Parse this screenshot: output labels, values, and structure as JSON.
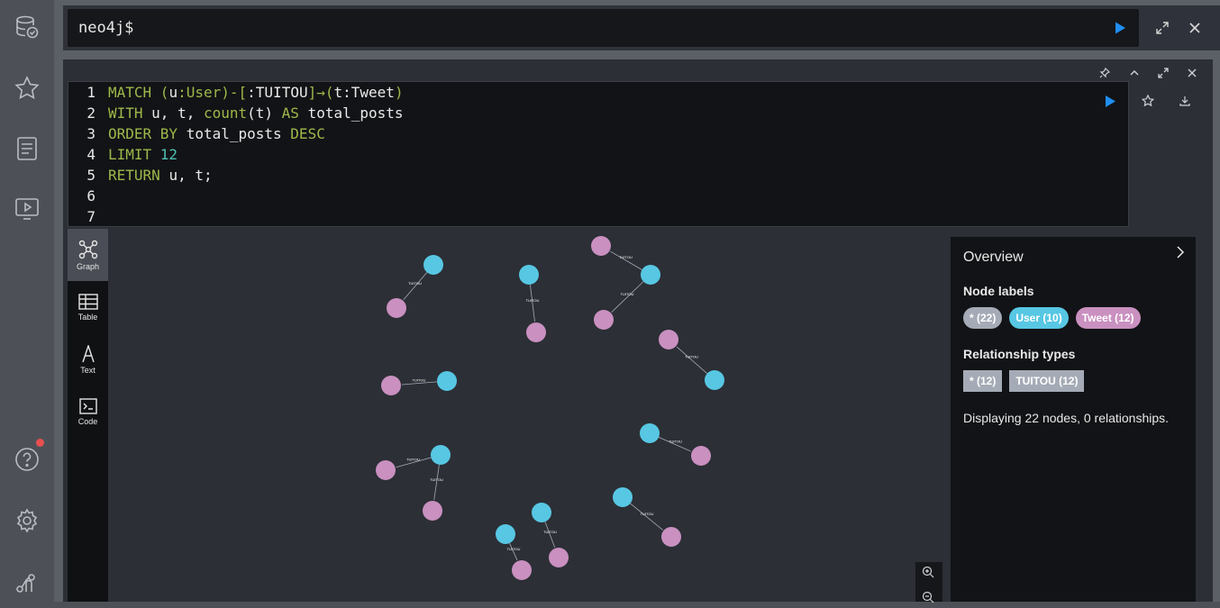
{
  "sidebar": {
    "items": [
      "database-icon",
      "star-icon",
      "document-icon",
      "play-guide-icon",
      "help-icon",
      "settings-icon",
      "neo4j-icon"
    ],
    "help_notification_color": "#e94f4f"
  },
  "editor": {
    "prompt": "neo4j$",
    "run_color": "#1f8ef1"
  },
  "query": {
    "lines": [
      {
        "num": "1",
        "tokens": [
          {
            "t": "MATCH",
            "c": "kw"
          },
          {
            "t": " (",
            "c": "lb"
          },
          {
            "t": "u",
            "c": "tx"
          },
          {
            "t": ":User",
            "c": "lb"
          },
          {
            "t": ")-[",
            "c": "lb"
          },
          {
            "t": ":TUITOU",
            "c": "tx"
          },
          {
            "t": "]→(",
            "c": "lb"
          },
          {
            "t": "t",
            "c": "tx"
          },
          {
            "t": ":Tweet",
            "c": "tx"
          },
          {
            "t": ")",
            "c": "lb"
          }
        ]
      },
      {
        "num": "2",
        "tokens": [
          {
            "t": "WITH ",
            "c": "kw"
          },
          {
            "t": "u, t, ",
            "c": "tx"
          },
          {
            "t": "count",
            "c": "lb"
          },
          {
            "t": "(t) ",
            "c": "tx"
          },
          {
            "t": "AS ",
            "c": "kw"
          },
          {
            "t": "total_posts",
            "c": "tx"
          }
        ]
      },
      {
        "num": "3",
        "tokens": [
          {
            "t": "ORDER BY ",
            "c": "kw"
          },
          {
            "t": "total_posts ",
            "c": "tx"
          },
          {
            "t": "DESC",
            "c": "kw"
          }
        ]
      },
      {
        "num": "4",
        "tokens": [
          {
            "t": "LIMIT ",
            "c": "kw"
          },
          {
            "t": "12",
            "c": "num"
          }
        ]
      },
      {
        "num": "5",
        "tokens": [
          {
            "t": "RETURN ",
            "c": "kw"
          },
          {
            "t": "u, t;",
            "c": "tx"
          }
        ]
      },
      {
        "num": "6",
        "tokens": []
      },
      {
        "num": "7",
        "tokens": []
      }
    ]
  },
  "views": {
    "graph": "Graph",
    "table": "Table",
    "text": "Text",
    "code": "Code"
  },
  "overview": {
    "title": "Overview",
    "node_labels_heading": "Node labels",
    "node_labels": [
      {
        "label": "* (22)",
        "color": "#a5abb6"
      },
      {
        "label": "User (10)",
        "color": "#57c7e3"
      },
      {
        "label": "Tweet (12)",
        "color": "#c990c0"
      }
    ],
    "rel_types_heading": "Relationship types",
    "rel_types": [
      {
        "label": "* (12)",
        "color": "#a5abb6"
      },
      {
        "label": "TUITOU (12)",
        "color": "#a5abb6"
      }
    ],
    "status": "Displaying 22 nodes, 0 relationships."
  },
  "graph": {
    "user_color": "#57c7e3",
    "tweet_color": "#c990c0",
    "rel_type": "TUITOU"
  }
}
